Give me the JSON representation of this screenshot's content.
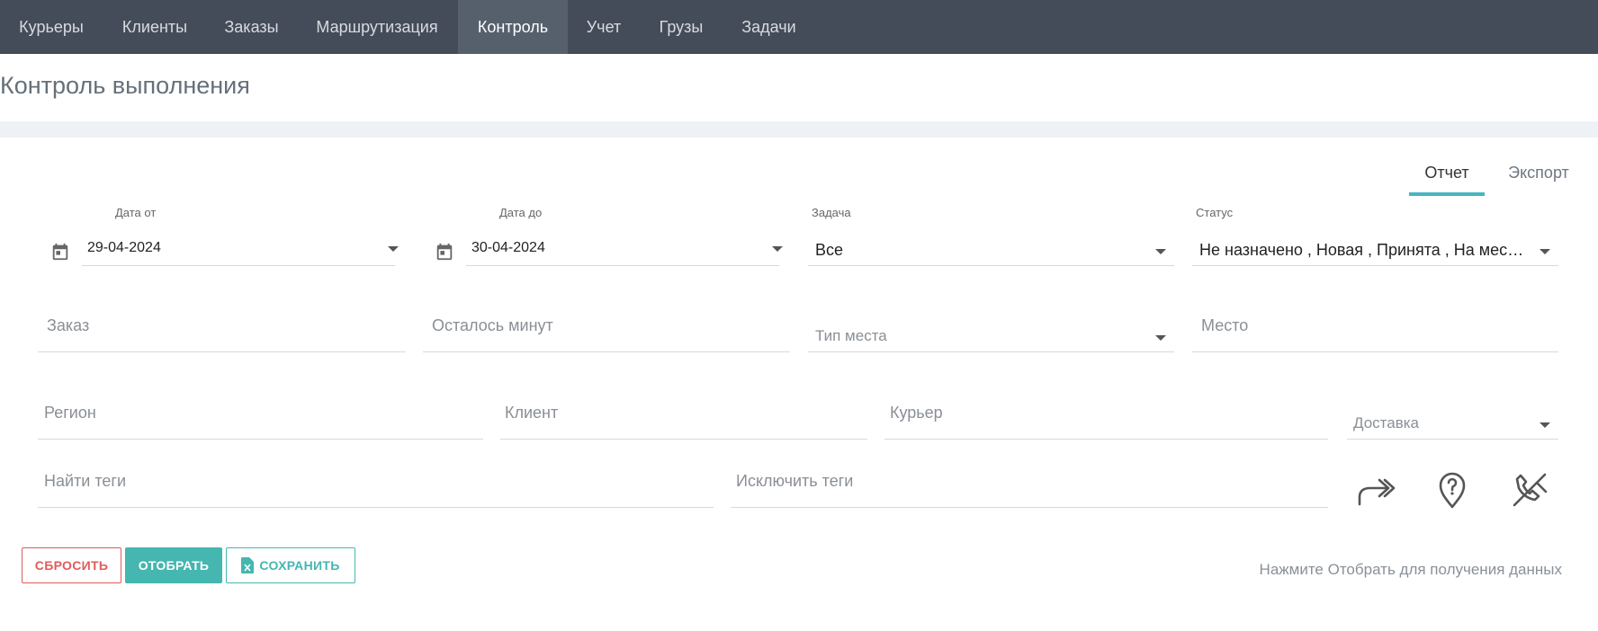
{
  "nav": {
    "items": [
      {
        "label": "Курьеры"
      },
      {
        "label": "Клиенты"
      },
      {
        "label": "Заказы"
      },
      {
        "label": "Маршрутизация"
      },
      {
        "label": "Контроль"
      },
      {
        "label": "Учет"
      },
      {
        "label": "Грузы"
      },
      {
        "label": "Задачи"
      }
    ],
    "active": "Контроль"
  },
  "page": {
    "title": "Контроль выполнения"
  },
  "tabs": [
    {
      "label": "Отчет",
      "active": true
    },
    {
      "label": "Экспорт",
      "active": false
    }
  ],
  "filters": {
    "date_from": {
      "label": "Дата от",
      "value": "29-04-2024"
    },
    "date_to": {
      "label": "Дата до",
      "value": "30-04-2024"
    },
    "task": {
      "label": "Задача",
      "value": "Все"
    },
    "status": {
      "label": "Статус",
      "value": "Не назначено , Новая , Принята , На месте..."
    },
    "order": {
      "placeholder": "Заказ"
    },
    "minutes_left": {
      "placeholder": "Осталось минут"
    },
    "place_type": {
      "placeholder": "Тип места"
    },
    "place": {
      "placeholder": "Место"
    },
    "region": {
      "placeholder": "Регион"
    },
    "client": {
      "placeholder": "Клиент"
    },
    "courier": {
      "placeholder": "Курьер"
    },
    "delivery": {
      "placeholder": "Доставка"
    },
    "find_tags": {
      "placeholder": "Найти теги"
    },
    "exclude_tags": {
      "placeholder": "Исключить теги"
    }
  },
  "icons": {
    "forward": "double-forward-arrow-icon",
    "location": "location-question-icon",
    "call_off": "phone-off-icon"
  },
  "buttons": {
    "reset": "СБРОСИТЬ",
    "select": "ОТОБРАТЬ",
    "save": "СОХРАНИТЬ"
  },
  "hint": "Нажмите Отобрать для получения данных",
  "colors": {
    "nav_bg": "#454c59",
    "accent": "#45b6b0",
    "tab_accent": "#45b6c0",
    "danger": "#e05b5b"
  }
}
